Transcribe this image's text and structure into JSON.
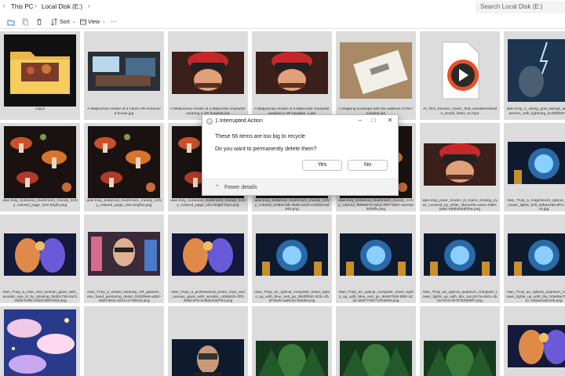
{
  "address_bar": {
    "crumbs": [
      "This PC",
      "Local Disk (E:)"
    ],
    "search_placeholder": "Search Local Disk (E:)"
  },
  "command_bar": {
    "sort_label": "Sort",
    "view_label": "View",
    "more_label": "···",
    "icons": [
      "new-folder-icon",
      "copy-icon",
      "delete-icon",
      "sort-icon",
      "view-icon"
    ]
  },
  "files": [
    {
      "caption": "copy1",
      "thumb": "folder"
    },
    {
      "caption": "A Midjourney render of a future AR-enhanced house.jpg",
      "thumb": "room"
    },
    {
      "caption": "A Midjourney render of a Mario-like character wearing a VR headset.jpg",
      "thumb": "mario"
    },
    {
      "caption": "A Midjourney render of a Mario-like character wearing a VR headset_1.jpg",
      "thumb": "mario"
    },
    {
      "caption": "A shipping envelope with the address of the recipient.jpg",
      "thumb": "envelope"
    },
    {
      "caption": "AI_Test_Kitchen_music_that_extraterrestrials_would_listen_to.mp3",
      "thumb": "media"
    },
    {
      "caption": "alan.truly_A_viking_god_swings_an_giant_hammer_with_lightning_5cd0f0b87e69.png",
      "thumb": "storm"
    },
    {
      "caption": "alan.truly_botanical_mushroom_moody_richly_colored_page_size-bright.png",
      "thumb": "mushroom"
    },
    {
      "caption": "alan.truly_botanical_mushroom_moody_richly_colored_page_size-bright2.png",
      "thumb": "mushroom"
    },
    {
      "caption": "alan.truly_botanical_mushroom_moody_richly_colored_page_size-bright-tops.png",
      "thumb": "mushroom"
    },
    {
      "caption": "alan.truly_botanical_mushroom_moody_richly_colored_0e5ba7ab-4036-a41d-c3254ec0d940.png",
      "thumb": "mushroom"
    },
    {
      "caption": "alan.truly_botanical_mushroom_moody_richly_colored_f8866672-63cd-4f97-9467-4ac0d29330fe.png",
      "thumb": "mushroom"
    },
    {
      "caption": "alan.truly_pixar_render_of_mario_smiling_eyes_covered_by_white_3be1ef3c-aeee-4d80-8a5c-696bd948f20e.png",
      "thumb": "mario"
    },
    {
      "caption": "Alan_Truly_a_magnificent_optical_computer_tower_lights_brill_0d52e48a-8f7c-4ee3-798c5.jpg",
      "thumb": "orb"
    },
    {
      "caption": "Alan_Truly_a_man_and_woman_gaze_with_wonder_eye_lit_by_glowing_b62bc730-0a71-48d0-b395-150d74b97593.png",
      "thumb": "faces"
    },
    {
      "caption": "Alan_Truly_a_model_wearing_AR_glasses_one_hand_gesturing_detail_032bf9e9-ad82-45d3-9011-a241ce730815.png",
      "thumb": "city"
    },
    {
      "caption": "Alan_Truly_a_professional_photo_man_and_woman_gaze_with_wonder_cd5551fe-f3f1-4b60-87a-ec825c53d794.png",
      "thumb": "faces"
    },
    {
      "caption": "Alan_Truly_an_optical_computer_tower_lights_up_with_blue_and_go_5bd0f040-223c-4b6f-8a25-aa814cc3a539.png",
      "thumb": "orb"
    },
    {
      "caption": "Alan_Truly_an_optical_computer_tower_lights_up_with_blue_and_go_6e657b28-9f60-42d1-a53f-729c71203e50.png",
      "thumb": "orb"
    },
    {
      "caption": "Alan_Truly_an_optical_quantum_computer_tower_lights_up_with_blu_1acc2c7a-4d41-4bbe-87ce-fb72753089f7.png",
      "thumb": "orb"
    },
    {
      "caption": "Alan_Truly_an_optical_quantum_computer_tower_lights_up_with_blu_b0ad5e75-2043-4e1c-125aa1a5cc0b.png",
      "thumb": "orb"
    },
    {
      "caption": "",
      "thumb": "clouds"
    },
    {
      "caption": "",
      "thumb": "blank"
    },
    {
      "caption": "",
      "thumb": "vrman"
    },
    {
      "caption": "",
      "thumb": "forest"
    },
    {
      "caption": "",
      "thumb": "forest"
    },
    {
      "caption": "",
      "thumb": "forest"
    },
    {
      "caption": "",
      "thumb": "faces"
    }
  ],
  "dialog": {
    "title": "1 Interrupted Action",
    "line1": "These 56 items are too big to recycle",
    "line2": "Do you want to permanently delete them?",
    "yes_label": "Yes",
    "no_label": "No",
    "fewer_details_label": "Fewer details",
    "window_controls": [
      "minimize-icon",
      "maximize-icon",
      "close-icon"
    ]
  }
}
